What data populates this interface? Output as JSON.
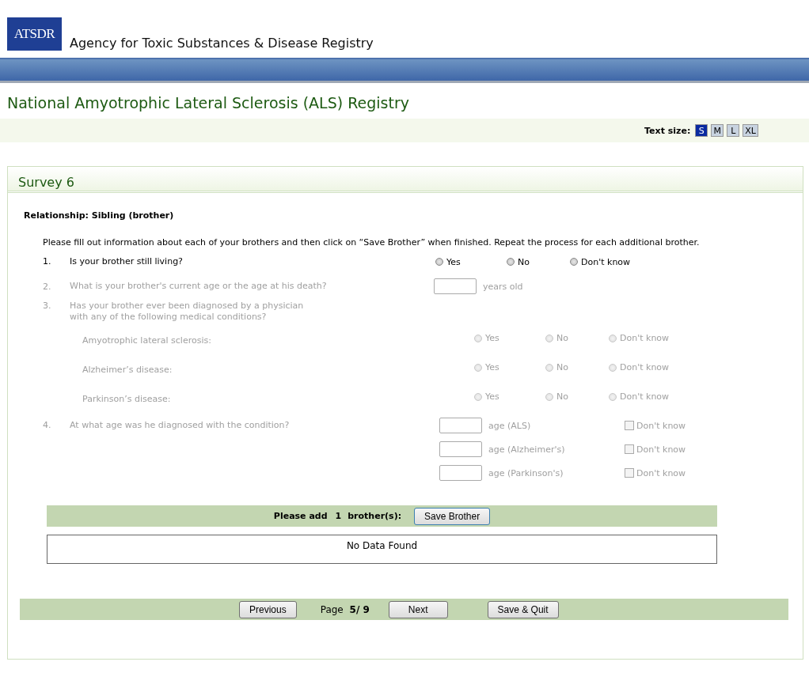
{
  "header": {
    "logo_text": "ATSDR",
    "agency": "Agency for Toxic Substances & Disease Registry"
  },
  "registry_title": "National Amyotrophic Lateral Sclerosis (ALS) Registry",
  "text_size": {
    "label": "Text size:",
    "options": [
      {
        "label": "S",
        "selected": true
      },
      {
        "label": "M",
        "selected": false
      },
      {
        "label": "L",
        "selected": false
      },
      {
        "label": "XL",
        "selected": false
      }
    ]
  },
  "survey": {
    "title": "Survey 6",
    "relationship": "Relationship: Sibling (brother)",
    "instructions": "Please fill out information about each of your brothers and then click on “Save Brother” when finished. Repeat the process for each additional brother.",
    "questions": [
      {
        "kind": "radio",
        "number": "1.",
        "text_lines": [
          "Is your brother still living?"
        ],
        "disabled": false,
        "options": [
          {
            "label": "Yes",
            "selected": false
          },
          {
            "label": "No",
            "selected": false
          },
          {
            "label": "Don't know",
            "selected": false
          }
        ]
      },
      {
        "kind": "age",
        "number": "2.",
        "text_lines": [
          "What is your brother's current age or the age at his death?"
        ],
        "disabled": true,
        "suffix": "years old"
      },
      {
        "kind": "conditions",
        "number": "3.",
        "text_lines": [
          "Has your brother ever been diagnosed by a physician",
          "with any of the following medical conditions?"
        ],
        "disabled": true,
        "rows": [
          {
            "label": "Amyotrophic lateral sclerosis:",
            "options": [
              {
                "label": "Yes",
                "selected": false
              },
              {
                "label": "No",
                "selected": false
              },
              {
                "label": "Don't know",
                "selected": false
              }
            ]
          },
          {
            "label": "Alzheimer’s disease:",
            "options": [
              {
                "label": "Yes",
                "selected": false
              },
              {
                "label": "No",
                "selected": false
              },
              {
                "label": "Don't know",
                "selected": false
              }
            ]
          },
          {
            "label": "Parkinson’s disease:",
            "options": [
              {
                "label": "Yes",
                "selected": false
              },
              {
                "label": "No",
                "selected": false
              },
              {
                "label": "Don't know",
                "selected": false
              }
            ]
          }
        ]
      },
      {
        "kind": "diagnosis_age",
        "number": "4.",
        "text_lines": [
          "At what age was he diagnosed with the condition?"
        ],
        "disabled": true,
        "rows": [
          {
            "suffix": "age (ALS)",
            "checkbox_label": "Don't know",
            "checked": false
          },
          {
            "suffix": "age (Alzheimer's)",
            "checkbox_label": "Don't know",
            "checked": false
          },
          {
            "suffix": "age (Parkinson's)",
            "checkbox_label": "Don't know",
            "checked": false
          }
        ]
      }
    ],
    "add_bar": {
      "prefix": "Please add",
      "count": "1",
      "suffix": "brother(s):",
      "button": "Save Brother"
    },
    "table_empty": "No Data Found",
    "nav": {
      "previous": "Previous",
      "page_label": "Page",
      "page": "5/ 9",
      "next": "Next",
      "save_quit": "Save & Quit"
    }
  }
}
